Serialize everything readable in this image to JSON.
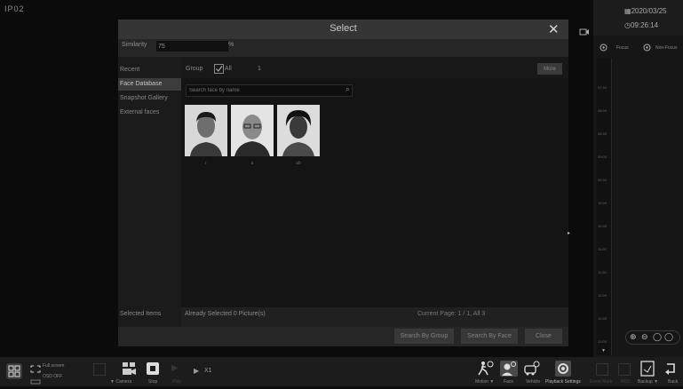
{
  "camera": {
    "label": "IP02"
  },
  "datetime": {
    "date": "2020/03/25",
    "time": "09:26:14"
  },
  "focus": {
    "focus_label": "Focus",
    "nonfocus_label": "Non-Focus"
  },
  "timeline": {
    "ticks": [
      "07:30",
      "08:00",
      "08:30",
      "09:00",
      "09:30",
      "10:00",
      "10:30",
      "11:00",
      "11:30",
      "12:00",
      "12:30",
      "13:00"
    ]
  },
  "dialog": {
    "title": "Select",
    "similarity": {
      "label": "Similarity",
      "value": "75",
      "unit": "%"
    },
    "nav": [
      {
        "label": "Recent"
      },
      {
        "label": "Face Database"
      },
      {
        "label": "Snapshot Gallery"
      },
      {
        "label": "External faces"
      }
    ],
    "selected_items_label": "Selected Items",
    "group_label": "Group",
    "all_label": "All",
    "count": "1",
    "more_label": "More",
    "search_placeholder": "Search face by name",
    "faces": [
      {
        "name": "r"
      },
      {
        "name": "a"
      },
      {
        "name": "ab"
      }
    ],
    "already_selected": "Already Selected 0 Picture(s)",
    "page_info": "Current Page: 1 / 1, All 3",
    "buttons": {
      "search_group": "Search By Group",
      "search_face": "Search By Face",
      "close": "Close"
    }
  },
  "bottom_bar": {
    "full_screen": "Full screen",
    "osd_off": "OSD OFF",
    "camera": "Camera",
    "stop": "Stop",
    "play": "Play",
    "speed": "X1",
    "motion": "Motion",
    "face": "Face",
    "vehicle": "Vehicle",
    "playback_settings": "Playback Settings",
    "event_mark": "Event Mark",
    "pos": "POS",
    "backup": "Backup",
    "back": "Back"
  },
  "colors": {
    "dialog_bg": "#1e1e1e",
    "header_bg": "#353535",
    "active_nav": "#3c3c3c"
  }
}
